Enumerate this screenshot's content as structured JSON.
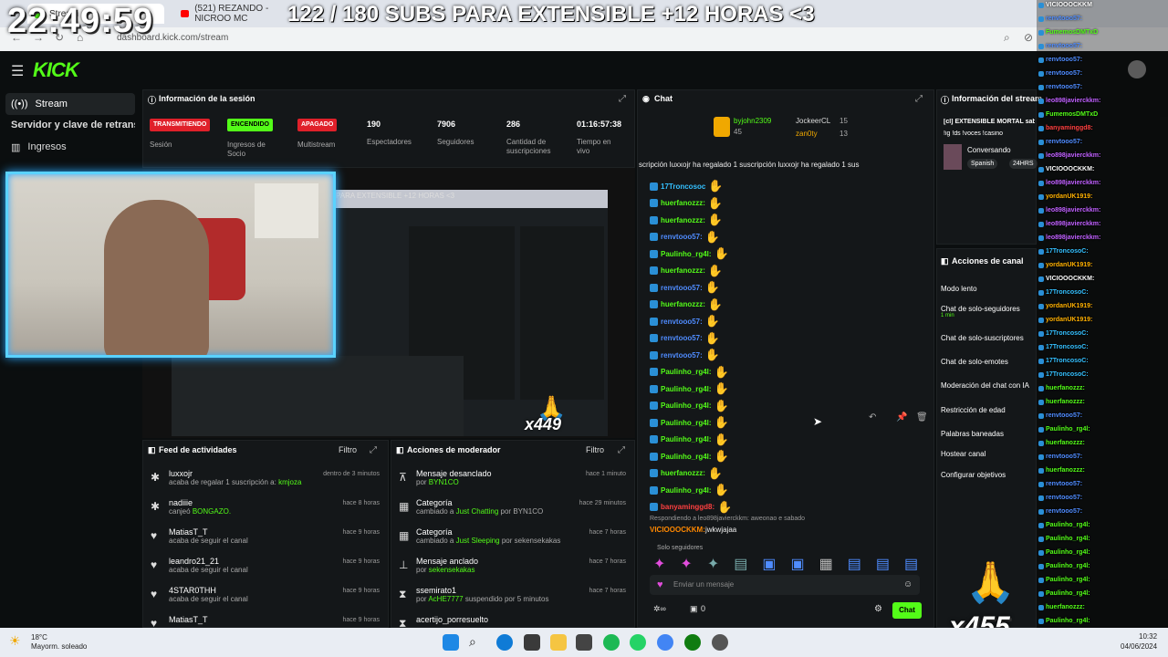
{
  "browser": {
    "tab1_title": "Stream",
    "tab2_title": "(521) REZANDO - NICROO MC",
    "address": "dashboard.kick.com/stream"
  },
  "overlay": {
    "clock": "22:49:59",
    "banner": "122 / 180 SUBS PARA EXTENSIBLE +12 HORAS <3",
    "inner_banner": "PARA EXTENSIBLE +12 HORAS <3",
    "gift_count_left": "x449",
    "gift_count_right": "x455"
  },
  "nav": {
    "logo": "KICK"
  },
  "sidebar": {
    "items": [
      {
        "label": "Stream"
      },
      {
        "label": "Servidor y clave de retransmisión"
      },
      {
        "label": "Ingresos"
      }
    ]
  },
  "session": {
    "title": "Información de la sesión",
    "badges": [
      {
        "label": "TRANSMITIENDO",
        "caption": "Sesión",
        "color": "#e0202a"
      },
      {
        "label": "ENCENDIDO",
        "caption": "Ingresos de Socio",
        "color": "#53fc18"
      },
      {
        "label": "APAGADO",
        "caption": "Multistream",
        "color": "#e0202a"
      }
    ],
    "stats": [
      {
        "value": "190",
        "label": "Espectadores"
      },
      {
        "value": "7906",
        "label": "Seguidores"
      },
      {
        "value": "286",
        "label": "Cantidad de suscripciones"
      },
      {
        "value": "01:16:57:38",
        "label": "Tiempo en vivo"
      }
    ]
  },
  "feed": {
    "title": "Feed de actividades",
    "filter": "Filtro",
    "items": [
      {
        "name": "luxxojr",
        "detail": "acaba de regalar 1 suscripción a:",
        "target": "kmjoza",
        "time": "dentro de 3 minutos"
      },
      {
        "name": "nadiiie",
        "detail": "canjeó",
        "target": "BONGAZO.",
        "time": "hace 8 horas"
      },
      {
        "name": "MatiasT_T",
        "detail": "acaba de seguir el canal",
        "target": "",
        "time": "hace 9 horas"
      },
      {
        "name": "leandro21_21",
        "detail": "acaba de seguir el canal",
        "target": "",
        "time": "hace 9 horas"
      },
      {
        "name": "4STAR0THH",
        "detail": "acaba de seguir el canal",
        "target": "",
        "time": "hace 9 horas"
      },
      {
        "name": "MatiasT_T",
        "detail": "",
        "target": "",
        "time": "hace 9 horas"
      }
    ]
  },
  "mod": {
    "title": "Acciones de moderador",
    "filter": "Filtro",
    "items": [
      {
        "name": "Mensaje desanclado",
        "detail": "por",
        "target": "BYN1CO",
        "time": "hace 1 minuto"
      },
      {
        "name": "Categoría",
        "detail": "cambiado a",
        "target": "Just Chatting",
        "extra": "por BYN1CO",
        "time": "hace 29 minutos"
      },
      {
        "name": "Categoría",
        "detail": "cambiado a",
        "target": "Just Sleeping",
        "extra": "por sekensekakas",
        "time": "hace 7 horas"
      },
      {
        "name": "Mensaje anclado",
        "detail": "por",
        "target": "sekensekakas",
        "time": "hace 7 horas"
      },
      {
        "name": "ssemirato1",
        "detail": "por",
        "target": "AcHE7777",
        "extra": "suspendido por 5 minutos",
        "time": "hace 7 horas"
      },
      {
        "name": "acertijo_porresuelto",
        "detail": "",
        "target": "",
        "time": ""
      }
    ]
  },
  "chat": {
    "title": "Chat",
    "top_gifters": [
      {
        "name": "byjohn2309",
        "count": "45"
      },
      {
        "name": "JockeerCL",
        "count": "15"
      },
      {
        "name": "zan0ty",
        "count": "13"
      }
    ],
    "ticker": "scripción  luxxojr ha regalado 1 suscripción  luxxojr ha regalado 1 sus",
    "messages": [
      {
        "user": "17Troncosoc",
        "color": "#34c0ff"
      },
      {
        "user": "huerfanozzz:",
        "color": "#53fc18"
      },
      {
        "user": "huerfanozzz:",
        "color": "#53fc18"
      },
      {
        "user": "renvtooo57:",
        "color": "#4f8cff"
      },
      {
        "user": "Paulinho_rg4l:",
        "color": "#53fc18"
      },
      {
        "user": "huerfanozzz:",
        "color": "#53fc18"
      },
      {
        "user": "renvtooo57:",
        "color": "#4f8cff"
      },
      {
        "user": "huerfanozzz:",
        "color": "#53fc18"
      },
      {
        "user": "renvtooo57:",
        "color": "#4f8cff"
      },
      {
        "user": "renvtooo57:",
        "color": "#4f8cff"
      },
      {
        "user": "renvtooo57:",
        "color": "#4f8cff"
      },
      {
        "user": "Paulinho_rg4l:",
        "color": "#53fc18"
      },
      {
        "user": "Paulinho_rg4l:",
        "color": "#53fc18"
      },
      {
        "user": "Paulinho_rg4l:",
        "color": "#53fc18"
      },
      {
        "user": "Paulinho_rg4l:",
        "color": "#53fc18"
      },
      {
        "user": "Paulinho_rg4l:",
        "color": "#53fc18"
      },
      {
        "user": "Paulinho_rg4l:",
        "color": "#53fc18"
      },
      {
        "user": "huerfanozzz:",
        "color": "#53fc18"
      },
      {
        "user": "Paulinho_rg4l:",
        "color": "#53fc18"
      },
      {
        "user": "banyaminggd8:",
        "color": "#ff4040"
      }
    ],
    "reply_context": "Respondiendo a leo898javierckkm: aweonao e sabado",
    "reply_user": "VICIOOOCKKM:",
    "reply_text": "jwkwjajaa",
    "followers_only": "Solo seguidores",
    "input_placeholder": "Enviar un mensaje",
    "send_label": "Chat",
    "points": "0"
  },
  "streaminfo": {
    "title": "Información del stream",
    "stream_title": "[cl] EXTENSIBLE MORTAL  sabado ORAS CTM",
    "commands": "!ig !ds !voces !casino",
    "category": "Conversando",
    "tags": [
      "Spanish",
      "24HRS"
    ]
  },
  "channel_actions": {
    "title": "Acciones de canal",
    "items": [
      {
        "label": "Modo lento"
      },
      {
        "label": "Chat de solo-seguidores",
        "sub": "1 min"
      },
      {
        "label": "Chat de solo-suscriptores"
      },
      {
        "label": "Chat de solo-emotes"
      },
      {
        "label": "Moderación del chat con IA"
      },
      {
        "label": "Restricción de edad"
      },
      {
        "label": "Palabras baneadas"
      },
      {
        "label": "Hostear canal"
      },
      {
        "label": "Configurar objetivos"
      }
    ]
  },
  "overlay_chat": [
    {
      "user": "VICIOOOCKKM",
      "color": "#ffffff"
    },
    {
      "user": "renvtooo57:",
      "color": "#4f8cff"
    },
    {
      "user": "FumemosDMTxD",
      "color": "#53fc18"
    },
    {
      "user": "renvtooo57:",
      "color": "#4f8cff"
    },
    {
      "user": "renvtooo57:",
      "color": "#4f8cff"
    },
    {
      "user": "renvtooo57:",
      "color": "#4f8cff"
    },
    {
      "user": "renvtooo57:",
      "color": "#4f8cff"
    },
    {
      "user": "leo898javierckkm:",
      "color": "#c060ff"
    },
    {
      "user": "FumemosDMTxD",
      "color": "#53fc18"
    },
    {
      "user": "banyaminggd8:",
      "color": "#ff4040"
    },
    {
      "user": "renvtooo57:",
      "color": "#4f8cff"
    },
    {
      "user": "leo898javierckkm:",
      "color": "#c060ff"
    },
    {
      "user": "VICIOOOCKKM:",
      "color": "#ffffff"
    },
    {
      "user": "leo898javierckkm:",
      "color": "#c060ff"
    },
    {
      "user": "yordanUK1919:",
      "color": "#ffb000"
    },
    {
      "user": "leo898javierckkm:",
      "color": "#c060ff"
    },
    {
      "user": "leo898javierckkm:",
      "color": "#c060ff"
    },
    {
      "user": "leo898javierckkm:",
      "color": "#c060ff"
    },
    {
      "user": "17TroncosoC:",
      "color": "#34c0ff"
    },
    {
      "user": "yordanUK1919:",
      "color": "#ffb000"
    },
    {
      "user": "VICIOOOCKKM:",
      "color": "#ffffff"
    },
    {
      "user": "17TroncosoC:",
      "color": "#34c0ff"
    },
    {
      "user": "yordanUK1919:",
      "color": "#ffb000"
    },
    {
      "user": "yordanUK1919:",
      "color": "#ffb000"
    },
    {
      "user": "17TroncosoC:",
      "color": "#34c0ff"
    },
    {
      "user": "17TroncosoC:",
      "color": "#34c0ff"
    },
    {
      "user": "17TroncosoC:",
      "color": "#34c0ff"
    },
    {
      "user": "17TroncosoC:",
      "color": "#34c0ff"
    },
    {
      "user": "huerfanozzz:",
      "color": "#53fc18"
    },
    {
      "user": "huerfanozzz:",
      "color": "#53fc18"
    },
    {
      "user": "renvtooo57:",
      "color": "#4f8cff"
    },
    {
      "user": "Paulinho_rg4l:",
      "color": "#53fc18"
    },
    {
      "user": "huerfanozzz:",
      "color": "#53fc18"
    },
    {
      "user": "renvtooo57:",
      "color": "#4f8cff"
    },
    {
      "user": "huerfanozzz:",
      "color": "#53fc18"
    },
    {
      "user": "renvtooo57:",
      "color": "#4f8cff"
    },
    {
      "user": "renvtooo57:",
      "color": "#4f8cff"
    },
    {
      "user": "renvtooo57:",
      "color": "#4f8cff"
    },
    {
      "user": "Paulinho_rg4l:",
      "color": "#53fc18"
    },
    {
      "user": "Paulinho_rg4l:",
      "color": "#53fc18"
    },
    {
      "user": "Paulinho_rg4l:",
      "color": "#53fc18"
    },
    {
      "user": "Paulinho_rg4l:",
      "color": "#53fc18"
    },
    {
      "user": "Paulinho_rg4l:",
      "color": "#53fc18"
    },
    {
      "user": "Paulinho_rg4l:",
      "color": "#53fc18"
    },
    {
      "user": "huerfanozzz:",
      "color": "#53fc18"
    },
    {
      "user": "Paulinho_rg4l:",
      "color": "#53fc18"
    },
    {
      "user": "VICIOOOCKKM:",
      "color": "#ffffff"
    }
  ],
  "taskbar": {
    "weather_temp": "18°C",
    "weather_desc": "Mayorm. soleado",
    "time": "10:32",
    "date": "04/06/2024"
  }
}
